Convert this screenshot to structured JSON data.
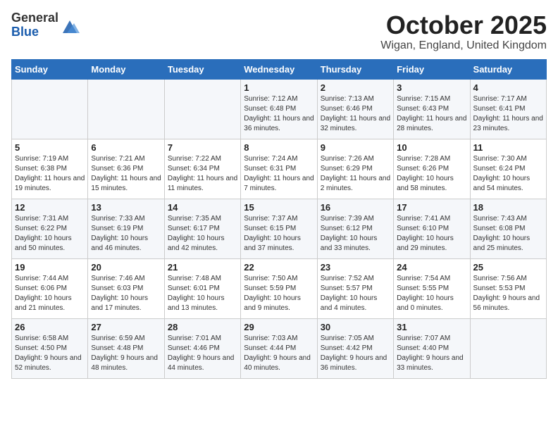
{
  "logo": {
    "general": "General",
    "blue": "Blue"
  },
  "title": "October 2025",
  "location": "Wigan, England, United Kingdom",
  "days_of_week": [
    "Sunday",
    "Monday",
    "Tuesday",
    "Wednesday",
    "Thursday",
    "Friday",
    "Saturday"
  ],
  "weeks": [
    [
      {
        "day": "",
        "sunrise": "",
        "sunset": "",
        "daylight": ""
      },
      {
        "day": "",
        "sunrise": "",
        "sunset": "",
        "daylight": ""
      },
      {
        "day": "",
        "sunrise": "",
        "sunset": "",
        "daylight": ""
      },
      {
        "day": "1",
        "sunrise": "Sunrise: 7:12 AM",
        "sunset": "Sunset: 6:48 PM",
        "daylight": "Daylight: 11 hours and 36 minutes."
      },
      {
        "day": "2",
        "sunrise": "Sunrise: 7:13 AM",
        "sunset": "Sunset: 6:46 PM",
        "daylight": "Daylight: 11 hours and 32 minutes."
      },
      {
        "day": "3",
        "sunrise": "Sunrise: 7:15 AM",
        "sunset": "Sunset: 6:43 PM",
        "daylight": "Daylight: 11 hours and 28 minutes."
      },
      {
        "day": "4",
        "sunrise": "Sunrise: 7:17 AM",
        "sunset": "Sunset: 6:41 PM",
        "daylight": "Daylight: 11 hours and 23 minutes."
      }
    ],
    [
      {
        "day": "5",
        "sunrise": "Sunrise: 7:19 AM",
        "sunset": "Sunset: 6:38 PM",
        "daylight": "Daylight: 11 hours and 19 minutes."
      },
      {
        "day": "6",
        "sunrise": "Sunrise: 7:21 AM",
        "sunset": "Sunset: 6:36 PM",
        "daylight": "Daylight: 11 hours and 15 minutes."
      },
      {
        "day": "7",
        "sunrise": "Sunrise: 7:22 AM",
        "sunset": "Sunset: 6:34 PM",
        "daylight": "Daylight: 11 hours and 11 minutes."
      },
      {
        "day": "8",
        "sunrise": "Sunrise: 7:24 AM",
        "sunset": "Sunset: 6:31 PM",
        "daylight": "Daylight: 11 hours and 7 minutes."
      },
      {
        "day": "9",
        "sunrise": "Sunrise: 7:26 AM",
        "sunset": "Sunset: 6:29 PM",
        "daylight": "Daylight: 11 hours and 2 minutes."
      },
      {
        "day": "10",
        "sunrise": "Sunrise: 7:28 AM",
        "sunset": "Sunset: 6:26 PM",
        "daylight": "Daylight: 10 hours and 58 minutes."
      },
      {
        "day": "11",
        "sunrise": "Sunrise: 7:30 AM",
        "sunset": "Sunset: 6:24 PM",
        "daylight": "Daylight: 10 hours and 54 minutes."
      }
    ],
    [
      {
        "day": "12",
        "sunrise": "Sunrise: 7:31 AM",
        "sunset": "Sunset: 6:22 PM",
        "daylight": "Daylight: 10 hours and 50 minutes."
      },
      {
        "day": "13",
        "sunrise": "Sunrise: 7:33 AM",
        "sunset": "Sunset: 6:19 PM",
        "daylight": "Daylight: 10 hours and 46 minutes."
      },
      {
        "day": "14",
        "sunrise": "Sunrise: 7:35 AM",
        "sunset": "Sunset: 6:17 PM",
        "daylight": "Daylight: 10 hours and 42 minutes."
      },
      {
        "day": "15",
        "sunrise": "Sunrise: 7:37 AM",
        "sunset": "Sunset: 6:15 PM",
        "daylight": "Daylight: 10 hours and 37 minutes."
      },
      {
        "day": "16",
        "sunrise": "Sunrise: 7:39 AM",
        "sunset": "Sunset: 6:12 PM",
        "daylight": "Daylight: 10 hours and 33 minutes."
      },
      {
        "day": "17",
        "sunrise": "Sunrise: 7:41 AM",
        "sunset": "Sunset: 6:10 PM",
        "daylight": "Daylight: 10 hours and 29 minutes."
      },
      {
        "day": "18",
        "sunrise": "Sunrise: 7:43 AM",
        "sunset": "Sunset: 6:08 PM",
        "daylight": "Daylight: 10 hours and 25 minutes."
      }
    ],
    [
      {
        "day": "19",
        "sunrise": "Sunrise: 7:44 AM",
        "sunset": "Sunset: 6:06 PM",
        "daylight": "Daylight: 10 hours and 21 minutes."
      },
      {
        "day": "20",
        "sunrise": "Sunrise: 7:46 AM",
        "sunset": "Sunset: 6:03 PM",
        "daylight": "Daylight: 10 hours and 17 minutes."
      },
      {
        "day": "21",
        "sunrise": "Sunrise: 7:48 AM",
        "sunset": "Sunset: 6:01 PM",
        "daylight": "Daylight: 10 hours and 13 minutes."
      },
      {
        "day": "22",
        "sunrise": "Sunrise: 7:50 AM",
        "sunset": "Sunset: 5:59 PM",
        "daylight": "Daylight: 10 hours and 9 minutes."
      },
      {
        "day": "23",
        "sunrise": "Sunrise: 7:52 AM",
        "sunset": "Sunset: 5:57 PM",
        "daylight": "Daylight: 10 hours and 4 minutes."
      },
      {
        "day": "24",
        "sunrise": "Sunrise: 7:54 AM",
        "sunset": "Sunset: 5:55 PM",
        "daylight": "Daylight: 10 hours and 0 minutes."
      },
      {
        "day": "25",
        "sunrise": "Sunrise: 7:56 AM",
        "sunset": "Sunset: 5:53 PM",
        "daylight": "Daylight: 9 hours and 56 minutes."
      }
    ],
    [
      {
        "day": "26",
        "sunrise": "Sunrise: 6:58 AM",
        "sunset": "Sunset: 4:50 PM",
        "daylight": "Daylight: 9 hours and 52 minutes."
      },
      {
        "day": "27",
        "sunrise": "Sunrise: 6:59 AM",
        "sunset": "Sunset: 4:48 PM",
        "daylight": "Daylight: 9 hours and 48 minutes."
      },
      {
        "day": "28",
        "sunrise": "Sunrise: 7:01 AM",
        "sunset": "Sunset: 4:46 PM",
        "daylight": "Daylight: 9 hours and 44 minutes."
      },
      {
        "day": "29",
        "sunrise": "Sunrise: 7:03 AM",
        "sunset": "Sunset: 4:44 PM",
        "daylight": "Daylight: 9 hours and 40 minutes."
      },
      {
        "day": "30",
        "sunrise": "Sunrise: 7:05 AM",
        "sunset": "Sunset: 4:42 PM",
        "daylight": "Daylight: 9 hours and 36 minutes."
      },
      {
        "day": "31",
        "sunrise": "Sunrise: 7:07 AM",
        "sunset": "Sunset: 4:40 PM",
        "daylight": "Daylight: 9 hours and 33 minutes."
      },
      {
        "day": "",
        "sunrise": "",
        "sunset": "",
        "daylight": ""
      }
    ]
  ]
}
